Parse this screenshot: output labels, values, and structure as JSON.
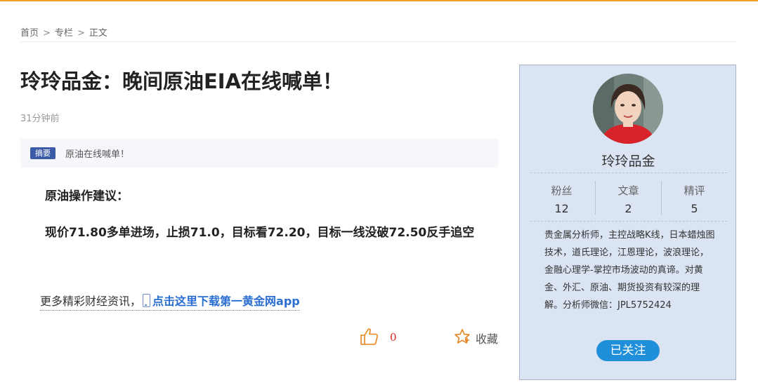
{
  "colors": {
    "accent": "#f0a020",
    "tag_bg": "#3b5aa8",
    "link": "#2a6ed1",
    "card_bg": "#dbe4f3",
    "follow_bg": "#1f8fd9",
    "like_count": "#e0221a"
  },
  "breadcrumb": {
    "home": "首页",
    "column": "专栏",
    "current": "正文",
    "separator": ">"
  },
  "article": {
    "title": "玲玲品金：晚间原油EIA在线喊单！",
    "time": "31分钟前",
    "summary_tag": "摘要",
    "summary": "原油在线喊单！",
    "paragraphs": [
      "原油操作建议：",
      "现价71.80多单进场，止损71.0，目标看72.20，目标一线没破72.50反手追空"
    ],
    "app_prefix": "更多精彩财经资讯，",
    "app_link": "点击这里下载第一黄金网app"
  },
  "actions": {
    "like_icon": "thumbs-up-icon",
    "like_count": "0",
    "fav_icon": "star-icon",
    "fav_label": "收藏"
  },
  "author": {
    "avatar_icon": "avatar-photo",
    "name": "玲玲品金",
    "stats": [
      {
        "label": "粉丝",
        "value": "12"
      },
      {
        "label": "文章",
        "value": "2"
      },
      {
        "label": "精评",
        "value": "5"
      }
    ],
    "bio": "贵金属分析师，主控战略K线，日本蜡烛图技术，道氏理论，江恩理论，波浪理论，金融心理学-掌控市场波动的真谛。对黄金、外汇、原油、期货投资有较深的理解。分析师微信：JPL5752424",
    "follow_label": "已关注"
  }
}
